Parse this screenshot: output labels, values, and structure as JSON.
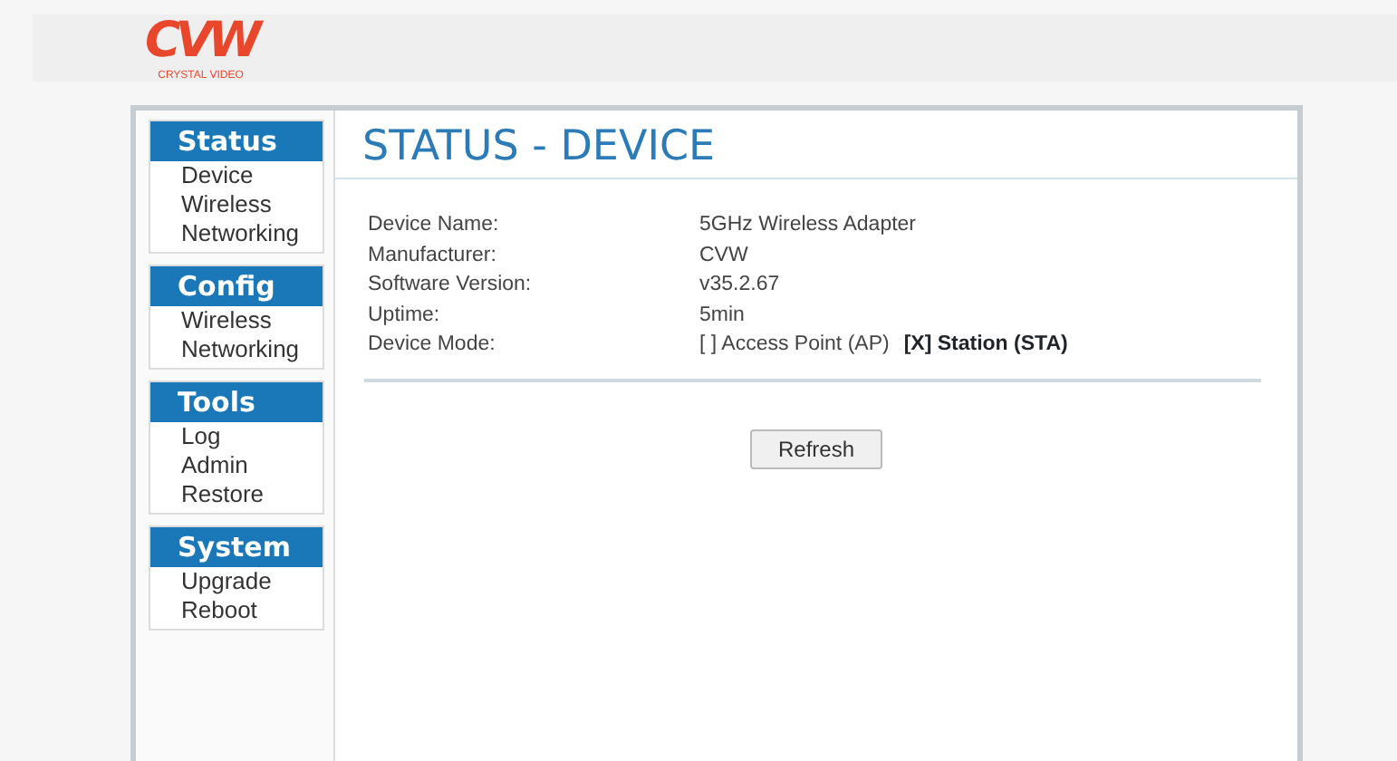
{
  "logo": {
    "mark": "CVW",
    "tagline": "CRYSTAL VIDEO"
  },
  "sidebar": [
    {
      "heading": "Status",
      "items": [
        "Device",
        "Wireless",
        "Networking"
      ]
    },
    {
      "heading": "Config",
      "items": [
        "Wireless",
        "Networking"
      ]
    },
    {
      "heading": "Tools",
      "items": [
        "Log",
        "Admin",
        "Restore"
      ]
    },
    {
      "heading": "System",
      "items": [
        "Upgrade",
        "Reboot"
      ]
    }
  ],
  "page_title": "STATUS - DEVICE",
  "fields": [
    {
      "label": "Device Name:",
      "value": "5GHz Wireless Adapter"
    },
    {
      "label": "Manufacturer:",
      "value": "CVW"
    },
    {
      "label": "Software Version:",
      "value": "v35.2.67"
    },
    {
      "label": "Uptime:",
      "value": "5min"
    }
  ],
  "device_mode": {
    "label": "Device Mode:",
    "options": [
      {
        "text": "[ ] Access Point (AP)",
        "selected": false
      },
      {
        "text": "[X] Station (STA)",
        "selected": true
      }
    ]
  },
  "refresh_button": "Refresh"
}
